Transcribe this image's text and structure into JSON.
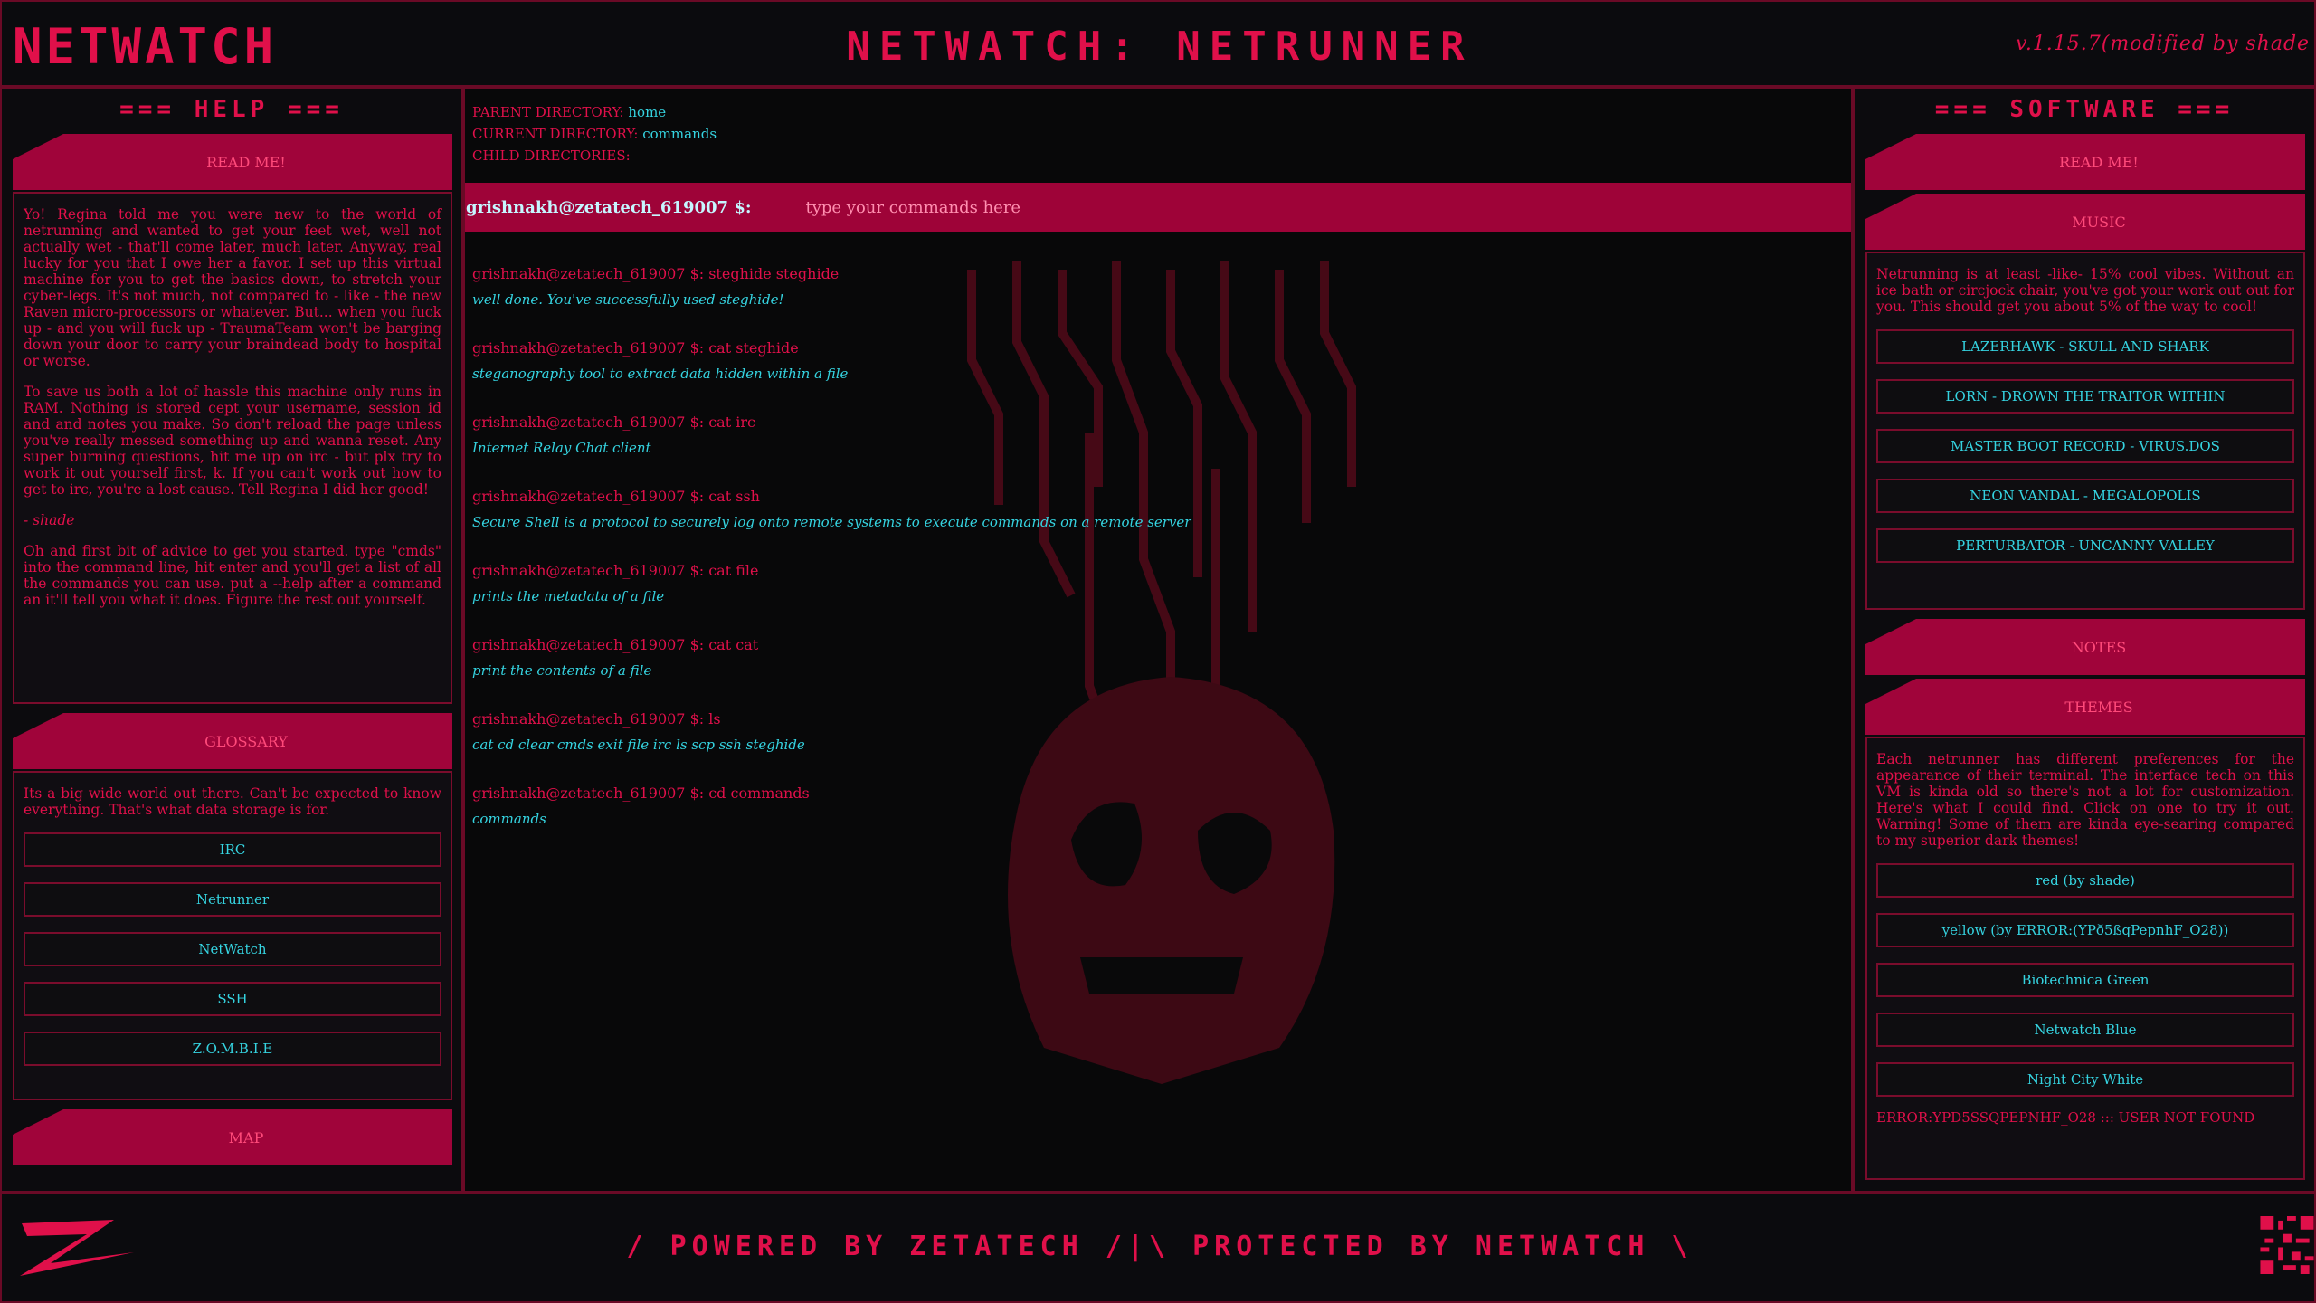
{
  "header": {
    "logo_text": "NETWATCH",
    "title": "NETWATCH: NETRUNNER",
    "version": "v.1.15.7(modified by shade"
  },
  "help": {
    "heading": "=== HELP ===",
    "readme_tab": "READ ME!",
    "readme_paragraphs": [
      "Yo! Regina told me you were new to the world of netrunning and wanted to get your feet wet, well not actually wet - that'll come later, much later. Anyway, real lucky for you that I owe her a favor. I set up this virtual machine for you to get the basics down, to stretch your cyber-legs. It's not much, not compared to - like - the new Raven micro-processors or whatever. But... when you fuck up - and you will fuck up - TraumaTeam won't be barging down your door to carry your braindead body to hospital or worse.",
      "To save us both a lot of hassle this machine only runs in RAM. Nothing is stored cept your username, session id and and notes you make. So don't reload the page unless you've really messed something up and wanna reset. Any super burning questions, hit me up on irc - but plx try to work it out yourself first, k. If you can't work out how to get to irc, you're a lost cause. Tell Regina I did her good!",
      "- shade",
      "Oh and first bit of advice to get you started. type \"cmds\" into the command line, hit enter and you'll get a list of all the commands you can use. put a --help after a command an it'll tell you what it does. Figure the rest out yourself."
    ],
    "glossary_tab": "GLOSSARY",
    "glossary_text": "Its a big wide world out there. Can't be expected to know everything. That's what data storage is for.",
    "glossary_items": [
      "IRC",
      "Netrunner",
      "NetWatch",
      "SSH",
      "Z.O.M.B.I.E"
    ],
    "map_tab": "MAP"
  },
  "terminal": {
    "parent_label": "PARENT DIRECTORY:",
    "parent_value": "home",
    "current_label": "CURRENT DIRECTORY:",
    "current_value": "commands",
    "child_label": "CHILD DIRECTORIES:",
    "child_value": "",
    "prompt": "grishnakh@zetatech_619007 $:",
    "input_placeholder": "type your commands here",
    "log": [
      {
        "cmd": "grishnakh@zetatech_619007 $: steghide steghide",
        "out": "well done. You've successfully used steghide!"
      },
      {
        "cmd": "grishnakh@zetatech_619007 $: cat steghide",
        "out": "steganography tool to extract data hidden within a file"
      },
      {
        "cmd": "grishnakh@zetatech_619007 $: cat irc",
        "out": "Internet Relay Chat client"
      },
      {
        "cmd": "grishnakh@zetatech_619007 $: cat ssh",
        "out": "Secure Shell is a protocol to securely log onto remote systems to execute commands on a remote server"
      },
      {
        "cmd": "grishnakh@zetatech_619007 $: cat file",
        "out": "prints the metadata of a file"
      },
      {
        "cmd": "grishnakh@zetatech_619007 $: cat cat",
        "out": "print the contents of a file"
      },
      {
        "cmd": "grishnakh@zetatech_619007 $: ls",
        "out": "cat cd clear cmds exit file irc ls scp ssh steghide"
      },
      {
        "cmd": "grishnakh@zetatech_619007 $: cd commands",
        "out": "commands"
      }
    ]
  },
  "software": {
    "heading": "=== SOFTWARE ===",
    "readme_tab": "READ ME!",
    "music_tab": "MUSIC",
    "music_text": "Netrunning is at least -like- 15% cool vibes. Without an ice bath or circjock chair, you've got your work out out for you. This should get you about 5% of the way to cool!",
    "music_items": [
      "LAZERHAWK - SKULL AND SHARK",
      "LORN - DROWN THE TRAITOR WITHIN",
      "MASTER BOOT RECORD - VIRUS.DOS",
      "NEON VANDAL - MEGALOPOLIS",
      "PERTURBATOR - UNCANNY VALLEY"
    ],
    "notes_tab": "NOTES",
    "themes_tab": "THEMES",
    "themes_text": "Each netrunner has different preferences for the appearance of their terminal. The interface tech on this VM is kinda old so there's not a lot for customization. Here's what I could find. Click on one to try it out. Warning! Some of them are kinda eye-searing compared to my superior dark themes!",
    "themes_items": [
      "red (by shade)",
      "yellow (by ERROR:(YPð5ßqPepnhF_O28))",
      "Biotechnica Green",
      "Netwatch Blue",
      "Night City White"
    ],
    "error_text": "ERROR:YPD5SSQPEPNHF_O28 ::: USER NOT FOUND"
  },
  "footer": {
    "text": "/ POWERED BY ZETATECH /|\\ PROTECTED BY NETWATCH \\"
  },
  "colors": {
    "accent": "#e0104a",
    "tab_fill": "#a0043a",
    "cyan_text": "#35d3e0",
    "background": "#0a0a0c"
  }
}
